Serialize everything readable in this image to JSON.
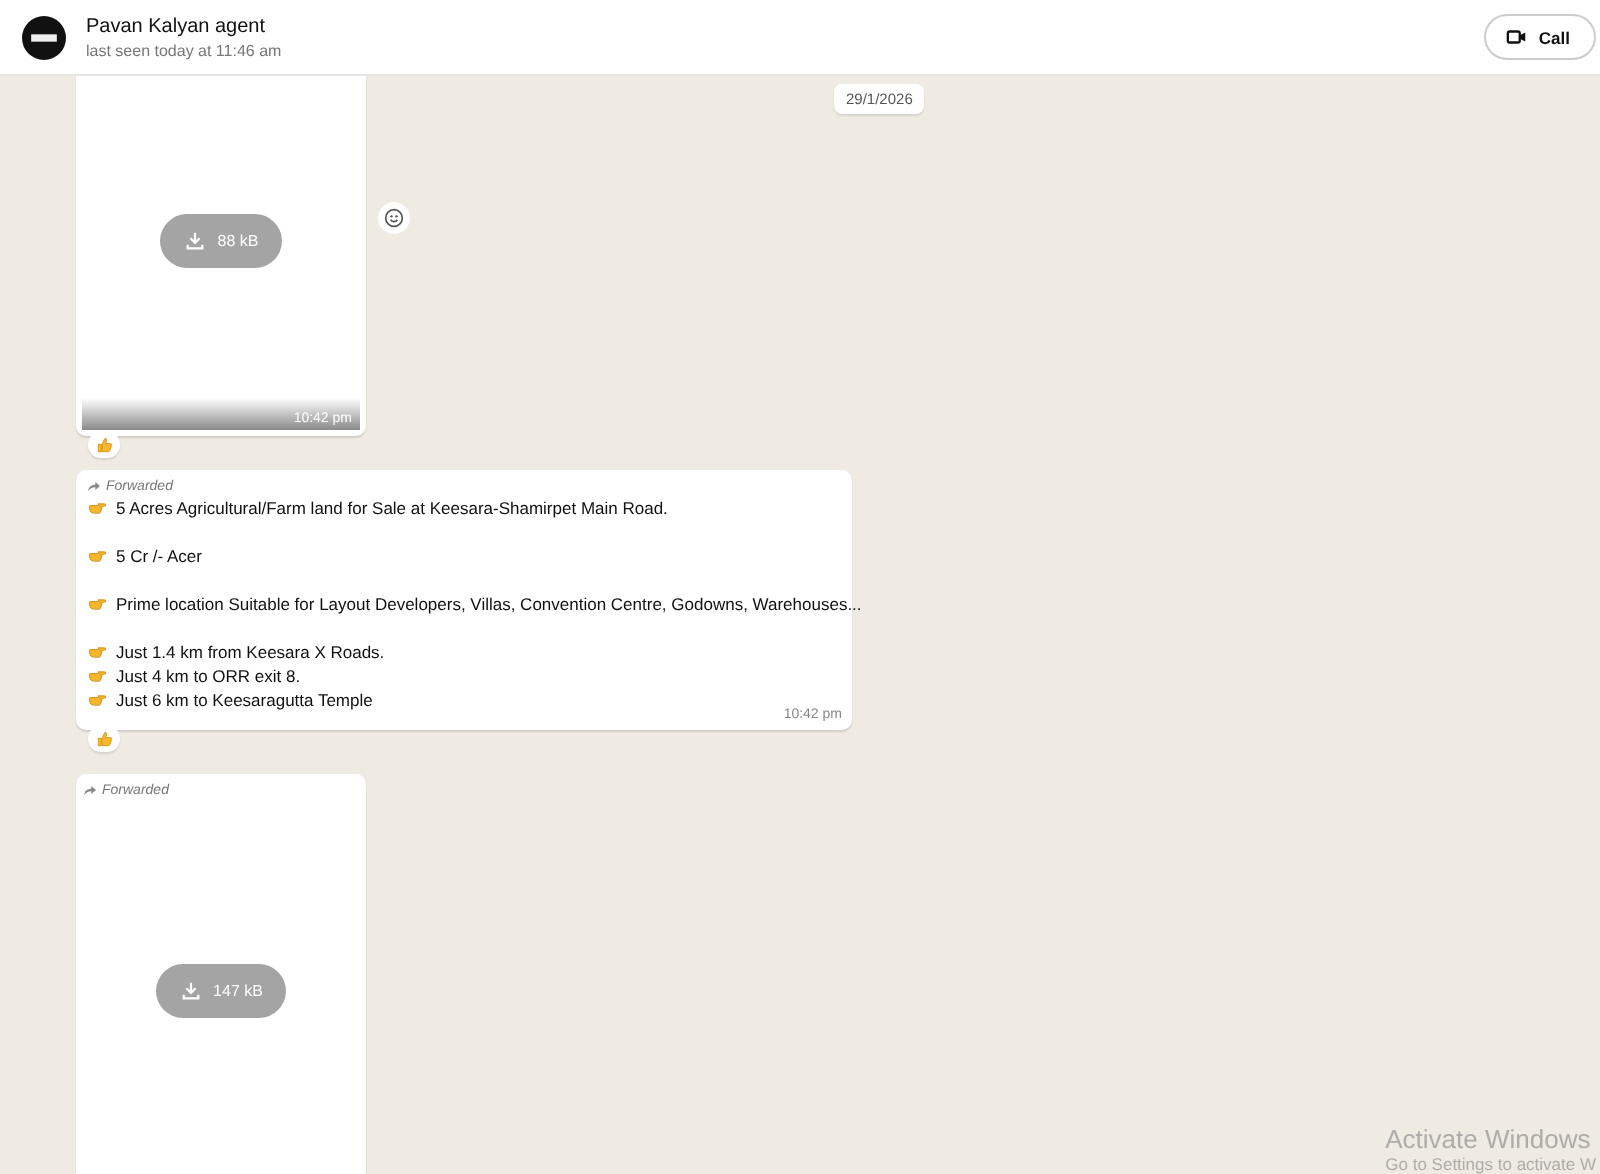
{
  "header": {
    "contact_name": "Pavan Kalyan agent",
    "status": "last seen today at 11:46 am",
    "call_button": "Call"
  },
  "date_chip": "29/1/2026",
  "messages": [
    {
      "kind": "file",
      "forwarded": false,
      "size": "88 kB",
      "time": "10:42 pm",
      "reacted": true,
      "react_button": true
    },
    {
      "kind": "text",
      "forwarded": true,
      "forward_label": "Forwarded",
      "lines": [
        {
          "kind": "point",
          "text": "5 Acres Agricultural/Farm land for Sale at Keesara-Shamirpet Main Road."
        },
        {
          "kind": "gap"
        },
        {
          "kind": "point",
          "text": "5 Cr /- Acer"
        },
        {
          "kind": "gap"
        },
        {
          "kind": "point",
          "text": "Prime location Suitable for Layout Developers, Villas, Convention Centre, Godowns, Warehouses..."
        },
        {
          "kind": "gap"
        },
        {
          "kind": "point",
          "text": "Just 1.4 km from Keesara X Roads."
        },
        {
          "kind": "point",
          "text": "Just 4 km to ORR exit 8."
        },
        {
          "kind": "point",
          "text": "Just 6 km to Keesaragutta Temple"
        }
      ],
      "time": "10:42 pm",
      "reacted": true,
      "react_button": false
    },
    {
      "kind": "file",
      "forwarded": true,
      "forward_label": "Forwarded",
      "size": "147 kB",
      "reacted": false,
      "react_button": false
    }
  ],
  "os_notice": {
    "title": "Activate Windows",
    "subtitle": "Go to Settings to activate W"
  }
}
